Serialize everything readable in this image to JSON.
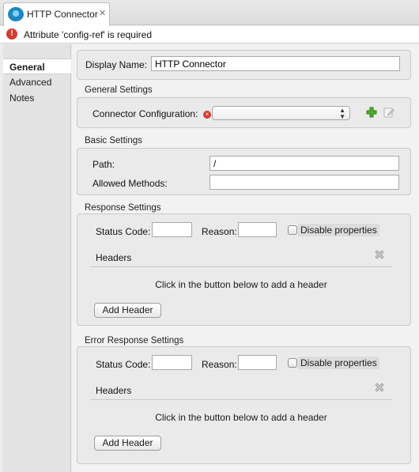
{
  "tab": {
    "title": "HTTP Connector",
    "close": "✕"
  },
  "error": {
    "message": "Attribute 'config-ref' is required"
  },
  "sidebar": {
    "items": [
      {
        "label": "General"
      },
      {
        "label": "Advanced"
      },
      {
        "label": "Notes"
      }
    ]
  },
  "display_name": {
    "label": "Display Name:",
    "value": "HTTP Connector"
  },
  "general_settings": {
    "title": "General Settings",
    "connector_configuration_label": "Connector Configuration:",
    "connector_configuration_value": ""
  },
  "basic_settings": {
    "title": "Basic Settings",
    "path_label": "Path:",
    "path_value": "/",
    "allowed_methods_label": "Allowed Methods:",
    "allowed_methods_value": ""
  },
  "response_settings": {
    "title": "Response Settings",
    "status_code_label": "Status Code:",
    "status_code_value": "",
    "reason_label": "Reason:",
    "reason_value": "",
    "disable_properties_label": "Disable properties",
    "headers_label": "Headers",
    "empty_headers_text": "Click in the button below to add a header",
    "add_header_label": "Add Header"
  },
  "error_response_settings": {
    "title": "Error Response Settings",
    "status_code_label": "Status Code:",
    "status_code_value": "",
    "reason_label": "Reason:",
    "reason_value": "",
    "disable_properties_label": "Disable properties",
    "headers_label": "Headers",
    "empty_headers_text": "Click in the button below to add a header",
    "add_header_label": "Add Header"
  }
}
